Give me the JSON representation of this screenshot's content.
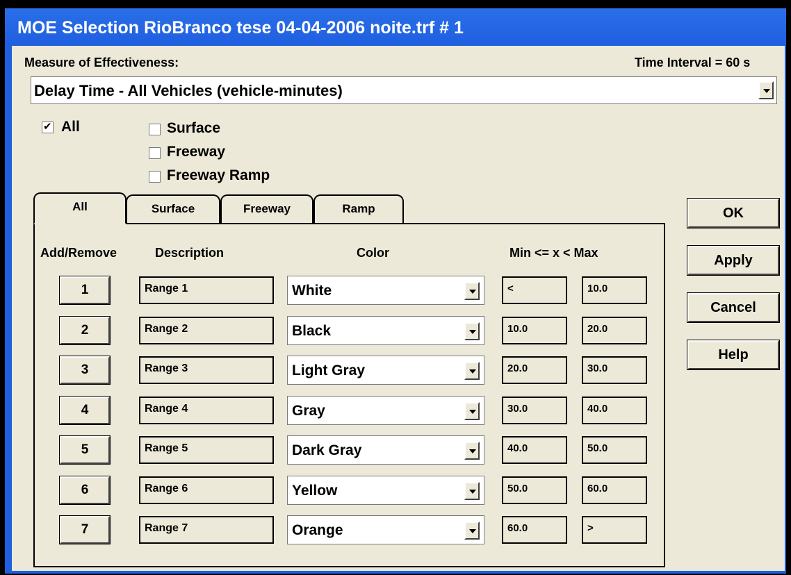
{
  "window": {
    "title": "MOE Selection  RioBranco tese 04-04-2006 noite.trf # 1"
  },
  "moe": {
    "label": "Measure of Effectiveness:",
    "time_interval": "Time Interval = 60 s",
    "selected": "Delay Time - All Vehicles (vehicle-minutes)"
  },
  "filters": {
    "all": {
      "label": "All",
      "checked": true
    },
    "surface": {
      "label": "Surface",
      "checked": false
    },
    "freeway": {
      "label": "Freeway",
      "checked": false
    },
    "freeway_ramp": {
      "label": "Freeway Ramp",
      "checked": false
    }
  },
  "tabs": [
    "All",
    "Surface",
    "Freeway",
    "Ramp"
  ],
  "active_tab": "All",
  "table": {
    "headers": {
      "add_remove": "Add/Remove",
      "description": "Description",
      "color": "Color",
      "range": "Min <= x < Max"
    },
    "rows": [
      {
        "num": "1",
        "desc": "Range 1",
        "color": "White",
        "min": "<",
        "max": "10.0"
      },
      {
        "num": "2",
        "desc": "Range 2",
        "color": "Black",
        "min": "10.0",
        "max": "20.0"
      },
      {
        "num": "3",
        "desc": "Range 3",
        "color": "Light Gray",
        "min": "20.0",
        "max": "30.0"
      },
      {
        "num": "4",
        "desc": "Range 4",
        "color": "Gray",
        "min": "30.0",
        "max": "40.0"
      },
      {
        "num": "5",
        "desc": "Range 5",
        "color": "Dark Gray",
        "min": "40.0",
        "max": "50.0"
      },
      {
        "num": "6",
        "desc": "Range 6",
        "color": "Yellow",
        "min": "50.0",
        "max": "60.0"
      },
      {
        "num": "7",
        "desc": "Range 7",
        "color": "Orange",
        "min": "60.0",
        "max": ">"
      }
    ]
  },
  "buttons": {
    "ok": "OK",
    "apply": "Apply",
    "cancel": "Cancel",
    "help": "Help"
  }
}
